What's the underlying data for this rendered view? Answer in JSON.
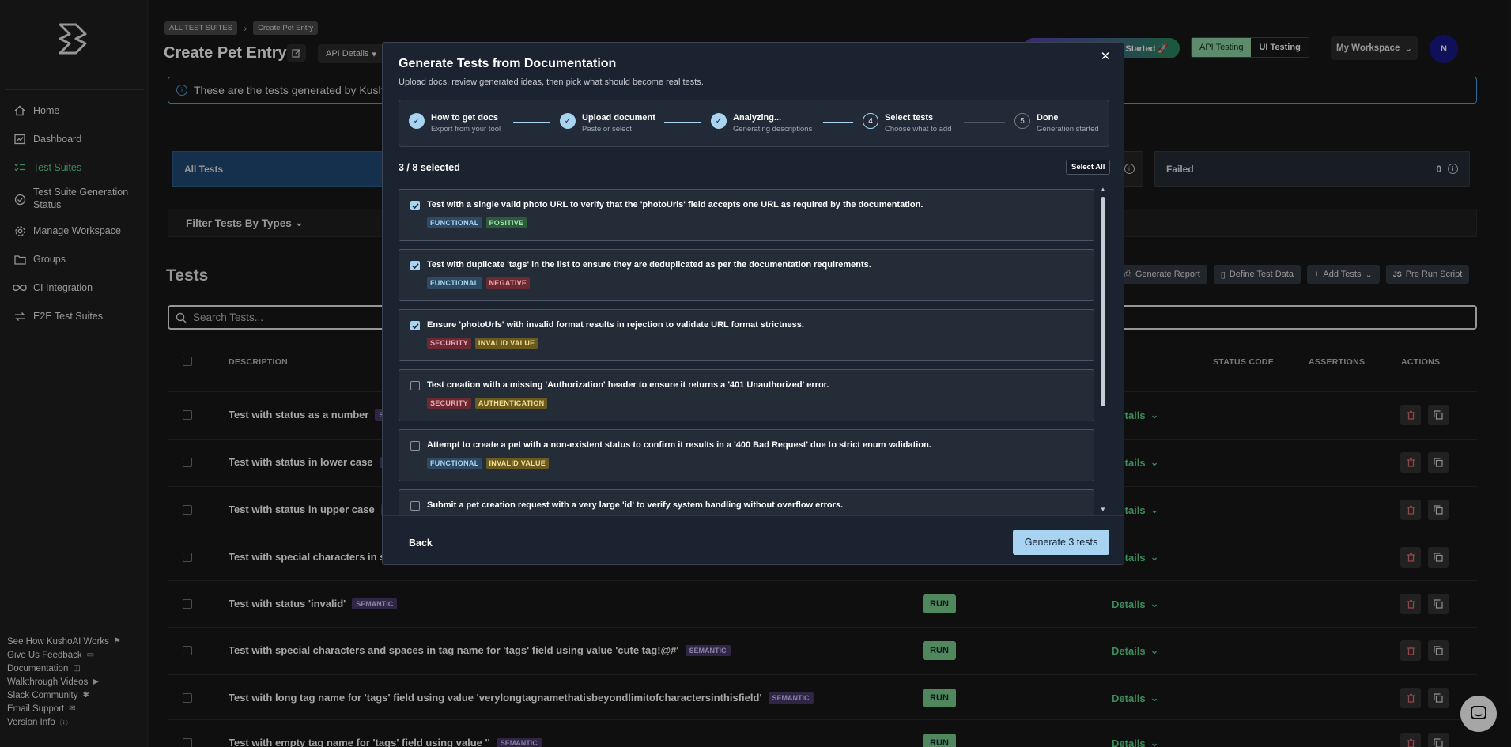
{
  "sidebar": {
    "items": [
      {
        "label": "Home",
        "icon": "home-icon"
      },
      {
        "label": "Dashboard",
        "icon": "dashboard-icon"
      },
      {
        "label": "Test Suites",
        "icon": "test-suites-icon"
      },
      {
        "label": "Test Suite Generation Status",
        "icon": "check-circle-icon"
      },
      {
        "label": "Manage Workspace",
        "icon": "gear-icon"
      },
      {
        "label": "Groups",
        "icon": "folder-icon"
      },
      {
        "label": "CI Integration",
        "icon": "infinity-icon"
      },
      {
        "label": "E2E Test Suites",
        "icon": "arrows-icon"
      }
    ],
    "bottom_links": [
      "See How KushoAI Works",
      "Give Us Feedback",
      "Documentation",
      "Walkthrough Videos",
      "Slack Community",
      "Email Support",
      "Version Info"
    ]
  },
  "breadcrumbs": [
    "ALL TEST SUITES",
    "Create Pet Entry"
  ],
  "page_title": "Create Pet Entry",
  "api_details_label": "API Details",
  "get_started_label": "Started 🚀",
  "mode_toggle": {
    "api": "API Testing",
    "ui": "UI Testing"
  },
  "workspace_label": "My Workspace",
  "avatar_initial": "N",
  "info_banner": "These are the tests generated by Kusho",
  "stats": {
    "all_label": "All Tests",
    "failed_label": "Failed",
    "failed_count": "0"
  },
  "filter_label": "Filter Tests By Types",
  "tests_title": "Tests",
  "toolbar": {
    "generate_report": "Generate Report",
    "define_test_data": "Define Test Data",
    "add_tests": "Add Tests",
    "pre_run_script": "Pre Run Script"
  },
  "search_placeholder": "Search Tests...",
  "table": {
    "headers": {
      "description": "DESCRIPTION",
      "status_code": "STATUS CODE",
      "assertions": "ASSERTIONS",
      "actions": "ACTIONS"
    },
    "run_label": "RUN",
    "details_label": "Details",
    "semantic_label": "SEMANTIC",
    "rows": [
      "Test with status as a number",
      "Test with status in lower case",
      "Test with status in upper case",
      "Test with special characters in st",
      "Test with status 'invalid'",
      "Test with special characters and spaces in tag name for 'tags' field using value 'cute tag!@#'",
      "Test with long tag name for 'tags' field using value 'verylongtagnamethatisbeyondlimitofcharactersinthisfield'",
      "Test with empty tag name for 'tags' field using value ''"
    ]
  },
  "modal": {
    "title": "Generate Tests from Documentation",
    "subtitle": "Upload docs, review generated ideas, then pick what should become real tests.",
    "steps": [
      {
        "title": "How to get docs",
        "sub": "Export from your tool",
        "state": "done"
      },
      {
        "title": "Upload document",
        "sub": "Paste or select",
        "state": "done"
      },
      {
        "title": "Analyzing...",
        "sub": "Generating descriptions",
        "state": "done"
      },
      {
        "title": "Select tests",
        "sub": "Choose what to add",
        "state": "current",
        "num": "4"
      },
      {
        "title": "Done",
        "sub": "Generation started",
        "state": "todo",
        "num": "5"
      }
    ],
    "selected_count": "3 / 8 selected",
    "select_all": "Select All",
    "items": [
      {
        "text": "Test with a single valid photo URL to verify that the 'photoUrls' field accepts one URL as required by the documentation.",
        "checked": true,
        "tags": [
          "FUNCTIONAL",
          "POSITIVE"
        ]
      },
      {
        "text": "Test with duplicate 'tags' in the list to ensure they are deduplicated as per the documentation requirements.",
        "checked": true,
        "tags": [
          "FUNCTIONAL",
          "NEGATIVE"
        ]
      },
      {
        "text": "Ensure 'photoUrls' with invalid format results in rejection to validate URL format strictness.",
        "checked": true,
        "tags": [
          "SECURITY",
          "INVALID VALUE"
        ]
      },
      {
        "text": "Test creation with a missing 'Authorization' header to ensure it returns a '401 Unauthorized' error.",
        "checked": false,
        "tags": [
          "SECURITY",
          "AUTHENTICATION"
        ]
      },
      {
        "text": "Attempt to create a pet with a non-existent status to confirm it results in a '400 Bad Request' due to strict enum validation.",
        "checked": false,
        "tags": [
          "FUNCTIONAL",
          "INVALID VALUE"
        ]
      },
      {
        "text": "Submit a pet creation request with a very large 'id' to verify system handling without overflow errors.",
        "checked": false,
        "tags": []
      }
    ],
    "back_label": "Back",
    "generate_label": "Generate 3 tests"
  },
  "colors": {
    "accent_green": "#5cd68b",
    "modal_accent": "#a8d4f2",
    "banner_blue": "#4aa3e6"
  }
}
